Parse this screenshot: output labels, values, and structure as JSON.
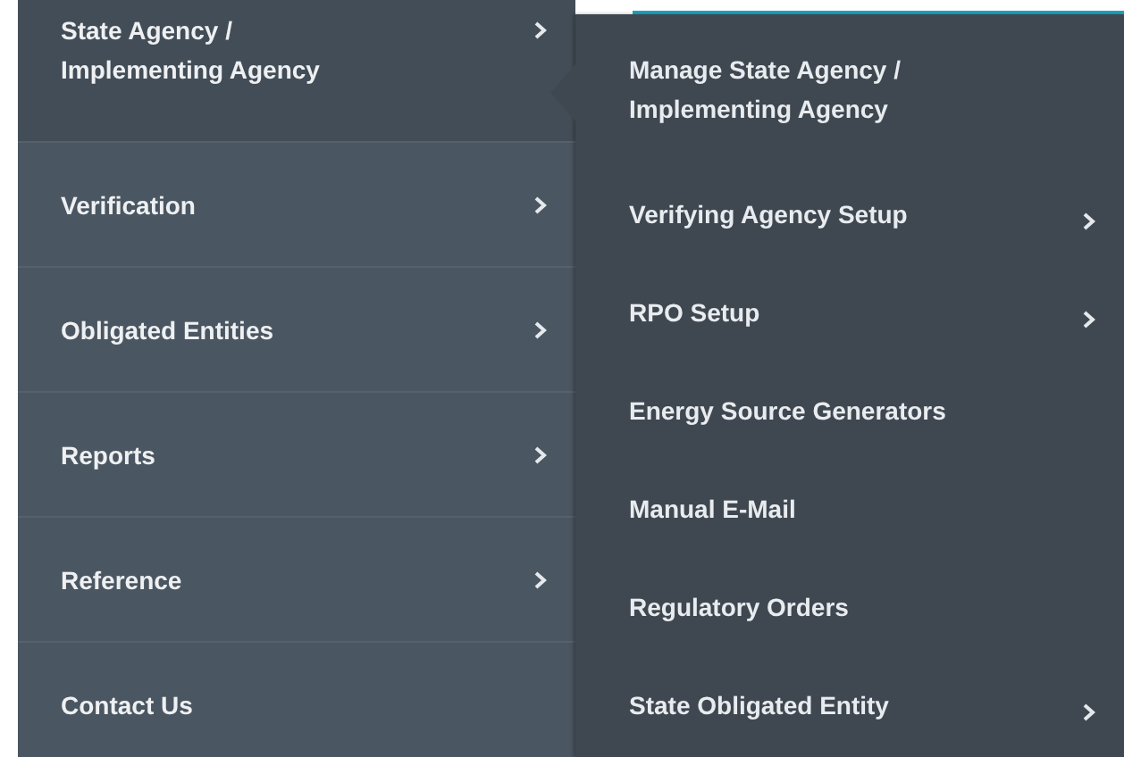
{
  "menu": {
    "items": [
      {
        "label": "State Agency / Implementing Agency",
        "has_submenu": true,
        "expanded": true
      },
      {
        "label": "Verification",
        "has_submenu": true,
        "expanded": false
      },
      {
        "label": "Obligated Entities",
        "has_submenu": true,
        "expanded": false
      },
      {
        "label": "Reports",
        "has_submenu": true,
        "expanded": false
      },
      {
        "label": "Reference",
        "has_submenu": true,
        "expanded": false
      },
      {
        "label": "Contact Us",
        "has_submenu": false,
        "expanded": false
      }
    ]
  },
  "submenu": {
    "items": [
      {
        "label": "Manage State Agency / Implementing Agency",
        "has_submenu": false
      },
      {
        "label": "Verifying Agency Setup",
        "has_submenu": true
      },
      {
        "label": "RPO Setup",
        "has_submenu": true
      },
      {
        "label": "Energy Source Generators",
        "has_submenu": false
      },
      {
        "label": "Manual E-Mail",
        "has_submenu": false
      },
      {
        "label": "Regulatory Orders",
        "has_submenu": false
      },
      {
        "label": "State Obligated Entity",
        "has_submenu": true
      }
    ]
  }
}
